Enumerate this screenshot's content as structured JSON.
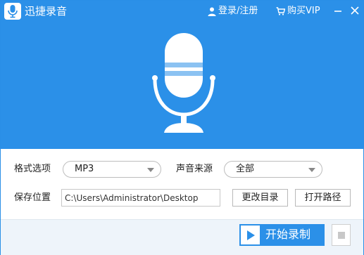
{
  "app": {
    "title": "迅捷录音",
    "login_label": "登录/注册",
    "vip_label": "购买VIP",
    "accent_color": "#2b90e8"
  },
  "icons": {
    "logo": "microphone-icon",
    "login": "user-icon",
    "vip": "cart-icon",
    "minimize": "minimize-icon",
    "close": "close-icon",
    "hero": "microphone-icon",
    "record": "play-icon",
    "stop": "stop-icon"
  },
  "settings": {
    "format_label": "格式选项",
    "format_value": "MP3",
    "source_label": "声音来源",
    "source_value": "全部",
    "save_label": "保存位置",
    "save_path": "C:\\Users\\Administrator\\Desktop",
    "change_dir_label": "更改目录",
    "open_path_label": "打开路径"
  },
  "footer": {
    "record_label": "开始录制"
  }
}
